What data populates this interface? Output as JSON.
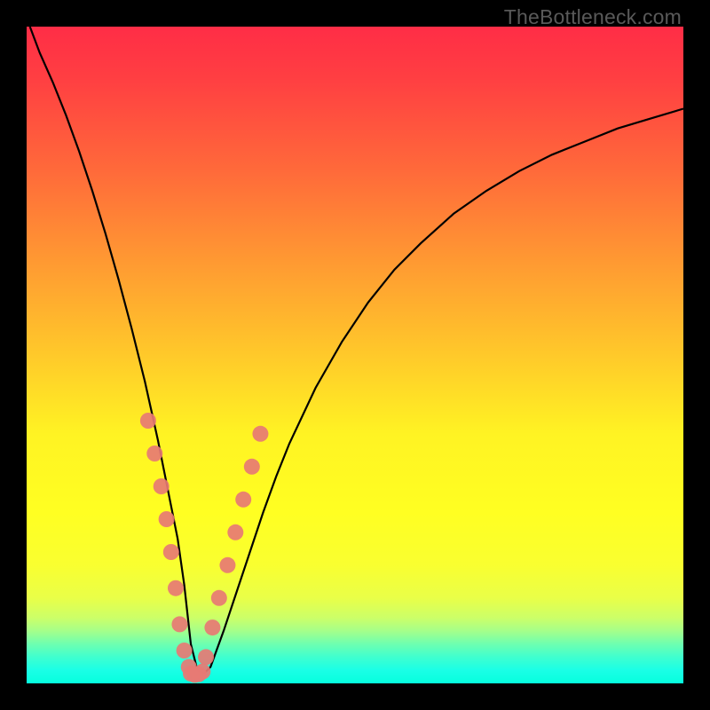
{
  "watermark_text": "TheBottleneck.com",
  "gradient": {
    "css": "background: linear-gradient(to bottom, #ff2d46 0%, #ff3f42 8%, #ff6a3a 22%, #ff9a32 36%, #ffc92a 50%, #fff323 62%, #ffff22 74%, #f9ff30 82%, #e9ff48 87%, #ccff68 90%, #a5ff8a 92%, #6effb0 94%, #3fffcf 96%, #1affe6 98%, #06ffde 100%);"
  },
  "chart_data": {
    "type": "line",
    "title": "",
    "xlabel": "",
    "ylabel": "",
    "xlim": [
      0,
      100
    ],
    "ylim": [
      0,
      100
    ],
    "x": [
      0.5,
      2,
      4,
      6,
      8,
      10,
      12,
      14,
      16,
      18,
      20,
      22,
      23,
      24,
      25,
      26,
      27,
      28,
      30,
      32,
      34,
      36,
      38,
      40,
      44,
      48,
      52,
      56,
      60,
      65,
      70,
      75,
      80,
      85,
      90,
      95,
      100
    ],
    "values": [
      100,
      96,
      91.5,
      86.5,
      81,
      75,
      68.5,
      61.5,
      54,
      46,
      37,
      27,
      22,
      15,
      6,
      2,
      1.5,
      2.5,
      8,
      14,
      20,
      26,
      31.5,
      36.5,
      45,
      52,
      58,
      63,
      67,
      71.5,
      75,
      78,
      80.5,
      82.5,
      84.5,
      86,
      87.5
    ],
    "points_left": {
      "x": [
        18.5,
        19.5,
        20.5,
        21.3,
        22.0,
        22.7,
        23.3,
        24.0,
        24.7
      ],
      "y": [
        40,
        35,
        30,
        25,
        20,
        14.5,
        9,
        5,
        2.5
      ]
    },
    "points_right": {
      "x": [
        27.3,
        28.3,
        29.3,
        30.6,
        31.8,
        33.0,
        34.3,
        35.6
      ],
      "y": [
        4,
        8.5,
        13,
        18,
        23,
        28,
        33,
        38
      ]
    },
    "points_bottom": {
      "x": [
        25.0,
        25.6,
        26.2,
        26.8
      ],
      "y": [
        1.5,
        1.3,
        1.4,
        1.8
      ]
    },
    "dot_radius": 9
  }
}
